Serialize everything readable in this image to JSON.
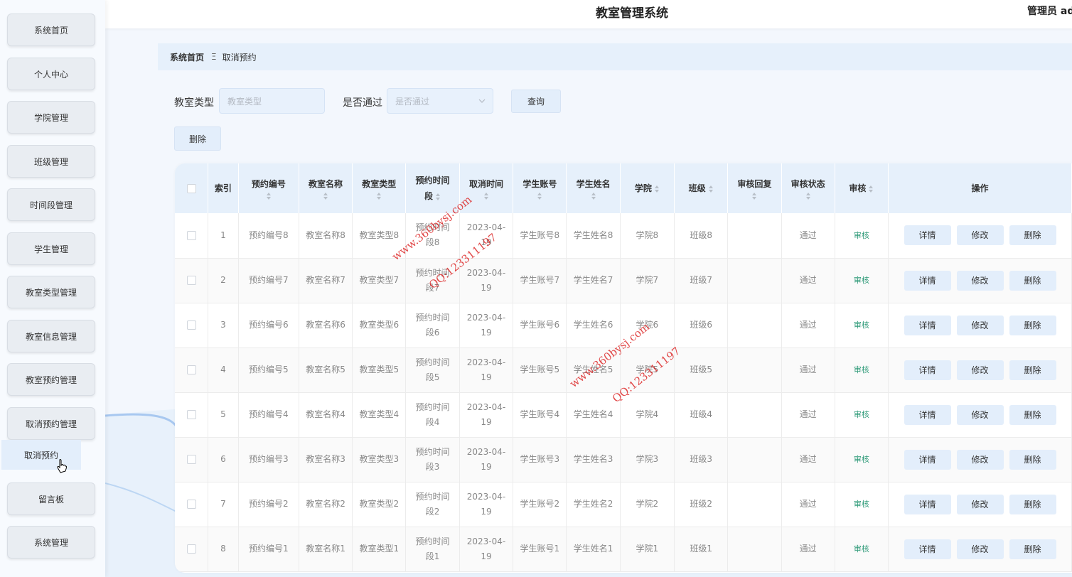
{
  "header": {
    "title": "教室管理系统",
    "user": "管理员 ad"
  },
  "sidebar": {
    "items": [
      {
        "label": "系统首页"
      },
      {
        "label": "个人中心"
      },
      {
        "label": "学院管理"
      },
      {
        "label": "班级管理"
      },
      {
        "label": "时间段管理"
      },
      {
        "label": "学生管理"
      },
      {
        "label": "教室类型管理"
      },
      {
        "label": "教室信息管理"
      },
      {
        "label": "教室预约管理"
      },
      {
        "label": "取消预约管理"
      },
      {
        "label": "留言板"
      },
      {
        "label": "系统管理"
      }
    ],
    "submenu": {
      "label": "取消预约"
    }
  },
  "breadcrumb": {
    "home": "系统首页",
    "separator": "Ξ",
    "current": "取消预约"
  },
  "search": {
    "room_type_label": "教室类型",
    "room_type_placeholder": "教室类型",
    "passed_label": "是否通过",
    "passed_placeholder": "是否通过",
    "query_button": "查询",
    "delete_button": "删除"
  },
  "table": {
    "headers": {
      "index": "索引",
      "booking_no": "预约编号",
      "room_name": "教室名称",
      "room_type": "教室类型",
      "time_slot_1": "预约时间",
      "time_slot_2": "段",
      "cancel_time": "取消时间",
      "student_account": "学生账号",
      "student_name": "学生姓名",
      "college": "学院",
      "class": "班级",
      "reply": "审核回复",
      "status": "审核状态",
      "audit": "审核",
      "ops": "操作"
    },
    "rows": [
      {
        "index": "1",
        "booking_no": "预约编号8",
        "room_name": "教室名称8",
        "room_type": "教室类型8",
        "slot_a": "预约时间",
        "slot_b": "段8",
        "date_a": "2023-04-",
        "date_b": "19",
        "account": "学生账号8",
        "name": "学生姓名8",
        "college": "学院8",
        "class": "班级8",
        "reply": "",
        "status": "通过",
        "audit": "审核"
      },
      {
        "index": "2",
        "booking_no": "预约编号7",
        "room_name": "教室名称7",
        "room_type": "教室类型7",
        "slot_a": "预约时间",
        "slot_b": "段7",
        "date_a": "2023-04-",
        "date_b": "19",
        "account": "学生账号7",
        "name": "学生姓名7",
        "college": "学院7",
        "class": "班级7",
        "reply": "",
        "status": "通过",
        "audit": "审核"
      },
      {
        "index": "3",
        "booking_no": "预约编号6",
        "room_name": "教室名称6",
        "room_type": "教室类型6",
        "slot_a": "预约时间",
        "slot_b": "段6",
        "date_a": "2023-04-",
        "date_b": "19",
        "account": "学生账号6",
        "name": "学生姓名6",
        "college": "学院6",
        "class": "班级6",
        "reply": "",
        "status": "通过",
        "audit": "审核"
      },
      {
        "index": "4",
        "booking_no": "预约编号5",
        "room_name": "教室名称5",
        "room_type": "教室类型5",
        "slot_a": "预约时间",
        "slot_b": "段5",
        "date_a": "2023-04-",
        "date_b": "19",
        "account": "学生账号5",
        "name": "学生姓名5",
        "college": "学院5",
        "class": "班级5",
        "reply": "",
        "status": "通过",
        "audit": "审核"
      },
      {
        "index": "5",
        "booking_no": "预约编号4",
        "room_name": "教室名称4",
        "room_type": "教室类型4",
        "slot_a": "预约时间",
        "slot_b": "段4",
        "date_a": "2023-04-",
        "date_b": "19",
        "account": "学生账号4",
        "name": "学生姓名4",
        "college": "学院4",
        "class": "班级4",
        "reply": "",
        "status": "通过",
        "audit": "审核"
      },
      {
        "index": "6",
        "booking_no": "预约编号3",
        "room_name": "教室名称3",
        "room_type": "教室类型3",
        "slot_a": "预约时间",
        "slot_b": "段3",
        "date_a": "2023-04-",
        "date_b": "19",
        "account": "学生账号3",
        "name": "学生姓名3",
        "college": "学院3",
        "class": "班级3",
        "reply": "",
        "status": "通过",
        "audit": "审核"
      },
      {
        "index": "7",
        "booking_no": "预约编号2",
        "room_name": "教室名称2",
        "room_type": "教室类型2",
        "slot_a": "预约时间",
        "slot_b": "段2",
        "date_a": "2023-04-",
        "date_b": "19",
        "account": "学生账号2",
        "name": "学生姓名2",
        "college": "学院2",
        "class": "班级2",
        "reply": "",
        "status": "通过",
        "audit": "审核"
      },
      {
        "index": "8",
        "booking_no": "预约编号1",
        "room_name": "教室名称1",
        "room_type": "教室类型1",
        "slot_a": "预约时间",
        "slot_b": "段1",
        "date_a": "2023-04-",
        "date_b": "19",
        "account": "学生账号1",
        "name": "学生姓名1",
        "college": "学院1",
        "class": "班级1",
        "reply": "",
        "status": "通过",
        "audit": "审核"
      }
    ],
    "row_actions": {
      "detail": "详情",
      "edit": "修改",
      "delete": "删除"
    }
  },
  "watermarks": {
    "site": "www.360bysj.com",
    "qq": "QQ:123311197"
  },
  "colors": {
    "accent_bg": "#e3eefb",
    "audit_link": "#2e9a78",
    "watermark": "#dc2828"
  }
}
